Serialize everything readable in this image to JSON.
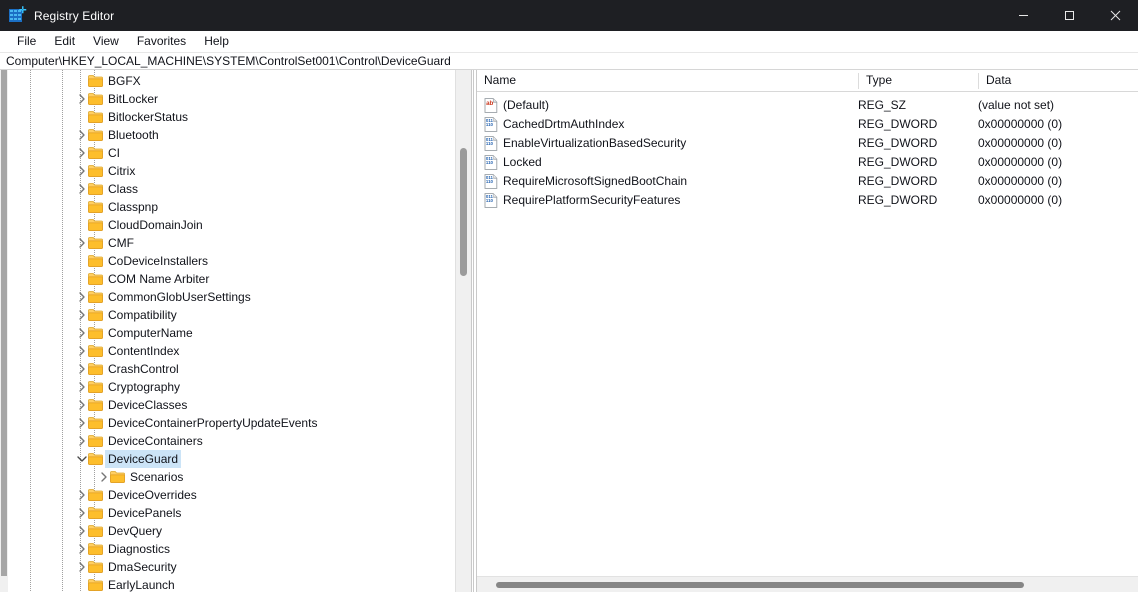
{
  "window": {
    "title": "Registry Editor",
    "icon": "registry-editor-icon",
    "controls": {
      "minimize": "minimize-icon",
      "maximize": "maximize-icon",
      "close": "close-icon"
    }
  },
  "menubar": {
    "items": [
      {
        "label": "File"
      },
      {
        "label": "Edit"
      },
      {
        "label": "View"
      },
      {
        "label": "Favorites"
      },
      {
        "label": "Help"
      }
    ]
  },
  "address": {
    "path": "Computer\\HKEY_LOCAL_MACHINE\\SYSTEM\\ControlSet001\\Control\\DeviceGuard"
  },
  "tree": {
    "items": [
      {
        "label": "BGFX",
        "depth": 4,
        "expander": "none",
        "selected": false,
        "expanded": false
      },
      {
        "label": "BitLocker",
        "depth": 4,
        "expander": "collapsed",
        "selected": false,
        "expanded": false
      },
      {
        "label": "BitlockerStatus",
        "depth": 4,
        "expander": "none",
        "selected": false,
        "expanded": false
      },
      {
        "label": "Bluetooth",
        "depth": 4,
        "expander": "collapsed",
        "selected": false,
        "expanded": false
      },
      {
        "label": "CI",
        "depth": 4,
        "expander": "collapsed",
        "selected": false,
        "expanded": false
      },
      {
        "label": "Citrix",
        "depth": 4,
        "expander": "collapsed",
        "selected": false,
        "expanded": false
      },
      {
        "label": "Class",
        "depth": 4,
        "expander": "collapsed",
        "selected": false,
        "expanded": false
      },
      {
        "label": "Classpnp",
        "depth": 4,
        "expander": "none",
        "selected": false,
        "expanded": false
      },
      {
        "label": "CloudDomainJoin",
        "depth": 4,
        "expander": "none",
        "selected": false,
        "expanded": false
      },
      {
        "label": "CMF",
        "depth": 4,
        "expander": "collapsed",
        "selected": false,
        "expanded": false
      },
      {
        "label": "CoDeviceInstallers",
        "depth": 4,
        "expander": "none",
        "selected": false,
        "expanded": false
      },
      {
        "label": "COM Name Arbiter",
        "depth": 4,
        "expander": "none",
        "selected": false,
        "expanded": false
      },
      {
        "label": "CommonGlobUserSettings",
        "depth": 4,
        "expander": "collapsed",
        "selected": false,
        "expanded": false
      },
      {
        "label": "Compatibility",
        "depth": 4,
        "expander": "collapsed",
        "selected": false,
        "expanded": false
      },
      {
        "label": "ComputerName",
        "depth": 4,
        "expander": "collapsed",
        "selected": false,
        "expanded": false
      },
      {
        "label": "ContentIndex",
        "depth": 4,
        "expander": "collapsed",
        "selected": false,
        "expanded": false
      },
      {
        "label": "CrashControl",
        "depth": 4,
        "expander": "collapsed",
        "selected": false,
        "expanded": false
      },
      {
        "label": "Cryptography",
        "depth": 4,
        "expander": "collapsed",
        "selected": false,
        "expanded": false
      },
      {
        "label": "DeviceClasses",
        "depth": 4,
        "expander": "collapsed",
        "selected": false,
        "expanded": false
      },
      {
        "label": "DeviceContainerPropertyUpdateEvents",
        "depth": 4,
        "expander": "collapsed",
        "selected": false,
        "expanded": false
      },
      {
        "label": "DeviceContainers",
        "depth": 4,
        "expander": "collapsed",
        "selected": false,
        "expanded": false
      },
      {
        "label": "DeviceGuard",
        "depth": 4,
        "expander": "expanded",
        "selected": true,
        "expanded": true
      },
      {
        "label": "Scenarios",
        "depth": 5,
        "expander": "collapsed",
        "selected": false,
        "expanded": false
      },
      {
        "label": "DeviceOverrides",
        "depth": 4,
        "expander": "collapsed",
        "selected": false,
        "expanded": false
      },
      {
        "label": "DevicePanels",
        "depth": 4,
        "expander": "collapsed",
        "selected": false,
        "expanded": false
      },
      {
        "label": "DevQuery",
        "depth": 4,
        "expander": "collapsed",
        "selected": false,
        "expanded": false
      },
      {
        "label": "Diagnostics",
        "depth": 4,
        "expander": "collapsed",
        "selected": false,
        "expanded": false
      },
      {
        "label": "DmaSecurity",
        "depth": 4,
        "expander": "collapsed",
        "selected": false,
        "expanded": false
      },
      {
        "label": "EarlyLaunch",
        "depth": 4,
        "expander": "none",
        "selected": false,
        "expanded": false
      }
    ]
  },
  "list": {
    "columns": [
      {
        "label": "Name"
      },
      {
        "label": "Type"
      },
      {
        "label": "Data"
      }
    ],
    "rows": [
      {
        "name": "(Default)",
        "type": "REG_SZ",
        "data": "(value not set)",
        "icon": "string-value-icon"
      },
      {
        "name": "CachedDrtmAuthIndex",
        "type": "REG_DWORD",
        "data": "0x00000000 (0)",
        "icon": "dword-value-icon"
      },
      {
        "name": "EnableVirtualizationBasedSecurity",
        "type": "REG_DWORD",
        "data": "0x00000000 (0)",
        "icon": "dword-value-icon"
      },
      {
        "name": "Locked",
        "type": "REG_DWORD",
        "data": "0x00000000 (0)",
        "icon": "dword-value-icon"
      },
      {
        "name": "RequireMicrosoftSignedBootChain",
        "type": "REG_DWORD",
        "data": "0x00000000 (0)",
        "icon": "dword-value-icon"
      },
      {
        "name": "RequirePlatformSecurityFeatures",
        "type": "REG_DWORD",
        "data": "0x00000000 (0)",
        "icon": "dword-value-icon"
      }
    ]
  },
  "colors": {
    "titlebar_bg": "#1e1f23",
    "selection": "#cce4f7",
    "folder": "#f7c346",
    "string_icon": "#cc3a20",
    "dword_icon": "#2563b0"
  }
}
